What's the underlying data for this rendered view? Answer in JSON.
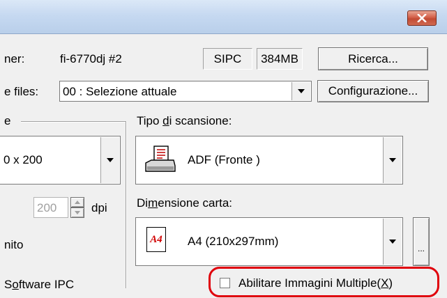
{
  "window": {
    "close_icon": "close-x-icon"
  },
  "scanner": {
    "label_partial": "ner:",
    "name": "fi-6770dj #2",
    "ipc_badge": "SIPC",
    "memory_badge": "384MB",
    "search_button": "Ricerca..."
  },
  "profile": {
    "label_partial": "e files:",
    "selected": "00 : Selezione attuale",
    "config_button": "Configurazione..."
  },
  "resolution_group": {
    "title_partial": "e",
    "selected_partial": "0 x 200",
    "custom_value": "200",
    "unit": "dpi",
    "label_partial": "nito"
  },
  "scan_type": {
    "label_before": "Tipo ",
    "label_mnemonic": "d",
    "label_after": "i scansione:",
    "icon": "adf-scanner-icon",
    "selected": "ADF (Fronte )"
  },
  "paper_size": {
    "label_before": "Di",
    "label_mnemonic": "m",
    "label_after": "ensione carta:",
    "icon_text": "A4",
    "selected": "A4 (210x297mm)",
    "more_button": "..."
  },
  "software_ipc": {
    "label_partial_before": "S",
    "label_mnemonic": "o",
    "label_after": "ftware IPC"
  },
  "multi_image": {
    "label_before": "Abilitare Immagini Multiple(",
    "label_mnemonic": "X",
    "label_after": ")",
    "checked": false,
    "highlight_color": "#e0000b"
  }
}
